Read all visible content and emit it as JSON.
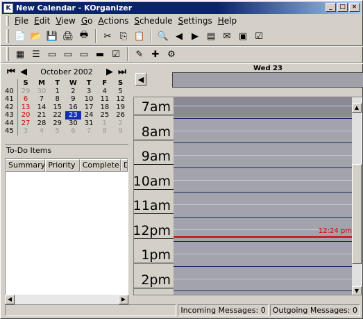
{
  "window": {
    "title": "New Calendar - KOrganizer"
  },
  "menu": [
    {
      "label": "File",
      "u": "F",
      "rest": "ile"
    },
    {
      "label": "Edit",
      "u": "E",
      "rest": "dit"
    },
    {
      "label": "View",
      "u": "V",
      "rest": "iew"
    },
    {
      "label": "Go",
      "u": "G",
      "rest": "o"
    },
    {
      "label": "Actions",
      "u": "A",
      "rest": "ctions"
    },
    {
      "label": "Schedule",
      "u": "S",
      "rest": "chedule"
    },
    {
      "label": "Settings",
      "u": "S",
      "rest": "ettings"
    },
    {
      "label": "Help",
      "u": "H",
      "rest": "elp"
    }
  ],
  "navigator": {
    "month_label": "October 2002",
    "weekday_headers": [
      "S",
      "M",
      "T",
      "W",
      "T",
      "F",
      "S"
    ],
    "weeks": [
      {
        "num": "40",
        "days": [
          "29",
          "30",
          "1",
          "2",
          "3",
          "4",
          "5"
        ]
      },
      {
        "num": "41",
        "days": [
          "6",
          "7",
          "8",
          "9",
          "10",
          "11",
          "12"
        ]
      },
      {
        "num": "42",
        "days": [
          "13",
          "14",
          "15",
          "16",
          "17",
          "18",
          "19"
        ]
      },
      {
        "num": "43",
        "days": [
          "20",
          "21",
          "22",
          "23",
          "24",
          "25",
          "26"
        ]
      },
      {
        "num": "44",
        "days": [
          "27",
          "28",
          "29",
          "30",
          "31",
          "1",
          "2"
        ]
      },
      {
        "num": "45",
        "days": [
          "3",
          "4",
          "5",
          "6",
          "7",
          "8",
          "9"
        ]
      }
    ],
    "selected_day": "23"
  },
  "todo": {
    "title": "To-Do Items",
    "columns": [
      "Summary",
      "Priority",
      "Complete",
      "D"
    ]
  },
  "day_view": {
    "day_label": "Wed 23",
    "hours": [
      "7am",
      "8am",
      "9am",
      "10am",
      "11am",
      "12pm",
      "1pm",
      "2pm"
    ],
    "current_time": "12:24 pm"
  },
  "status": {
    "incoming": "Incoming Messages: 0",
    "outgoing": "Outgoing Messages: 0"
  },
  "colors": {
    "title_bar": "#0a246a",
    "selected_day": "#1030b0",
    "now_line": "#d00000",
    "agenda_bg": "#a3a3ab"
  }
}
